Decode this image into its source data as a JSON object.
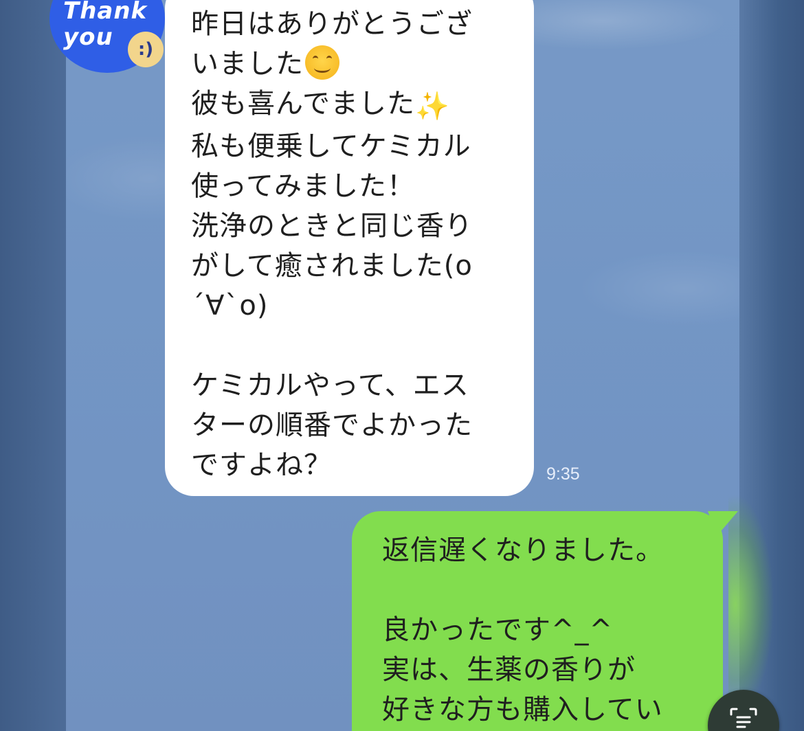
{
  "avatar": {
    "line1": "Thank",
    "line2": "you",
    "smiley": ":)"
  },
  "incoming": {
    "text_a": "昨日はありがとうござ\nいました",
    "text_b": "\n彼も喜んでました",
    "text_c": "\n私も便乗してケミカル\n使ってみました！\n洗浄のときと同じ香り\nがして癒されました(o\n´∀`o)\n\nケミカルやって、エス\nターの順番でよかった\nですよね？",
    "sparkle": "✨",
    "time": "9:35"
  },
  "outgoing": {
    "text": "返信遅くなりました。\n\n良かったです^_^\n実は、生薬の香りが\n好きな方も購入してい"
  },
  "colors": {
    "chat_background": "#7396c5",
    "incoming_bubble": "#ffffff",
    "outgoing_bubble": "#82dd4e",
    "avatar": "#2f5ee6"
  },
  "icons": {
    "scan": "scan-text-icon",
    "emoji_smile": "smiling-face-emoji",
    "emoji_sparkles": "sparkles-emoji"
  }
}
